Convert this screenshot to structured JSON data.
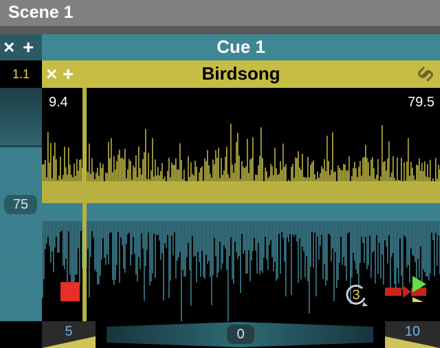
{
  "scene": {
    "title": "Scene 1"
  },
  "cue": {
    "title": "Cue 1",
    "close_glyph": "×",
    "add_glyph": "+"
  },
  "track": {
    "index": "1.1",
    "title": "Birdsong",
    "close_glyph": "×",
    "add_glyph": "+",
    "link_icon": "link-icon"
  },
  "waveform": {
    "start_time": "9.4",
    "end_time": "79.5",
    "colors": {
      "upper": "#b9b141",
      "lower": "#3d8090",
      "playhead": "#b9b141"
    }
  },
  "level": {
    "value": "75"
  },
  "transport": {
    "stop_icon": "stop-icon",
    "loop_icon": "loop-icon",
    "loop_count": "3",
    "play_icon": "play-icon",
    "stop_color": "#e52f27",
    "play_color": "#5ee04a"
  },
  "bottom": {
    "fade_in": "5",
    "fade_out": "10",
    "pan_value": "0"
  }
}
